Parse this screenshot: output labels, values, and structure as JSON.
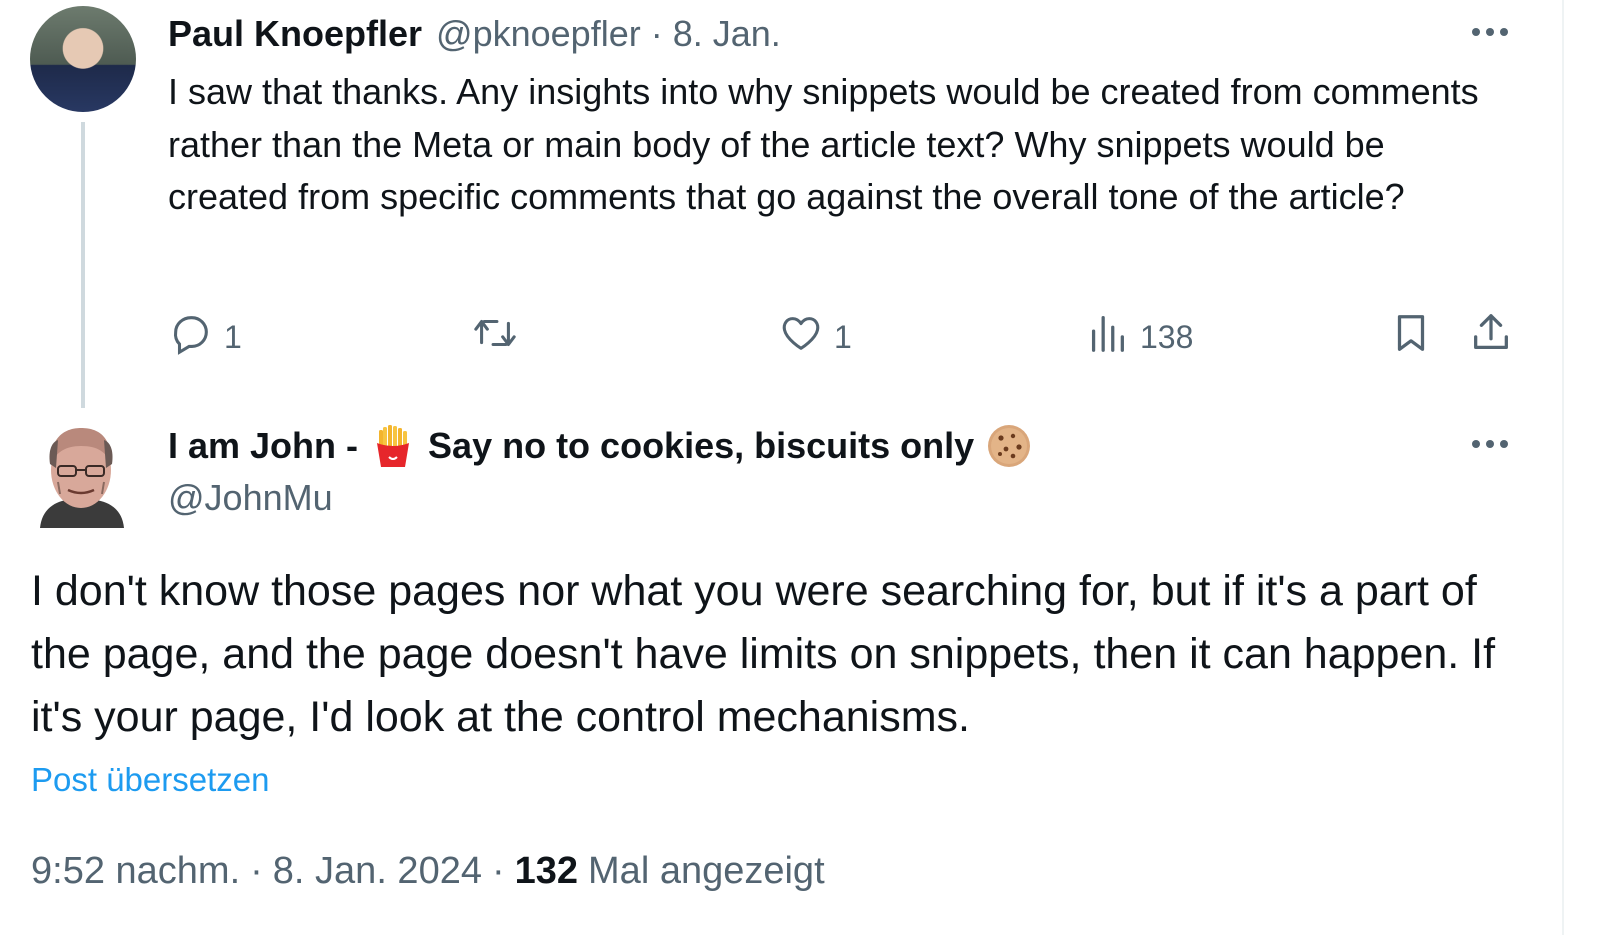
{
  "reply": {
    "author_name": "Paul Knoepfler",
    "author_handle": "@pknoepfler",
    "separator": "·",
    "date": "8. Jan.",
    "text": "I saw that thanks. Any insights into why snippets would be created from comments rather than the Meta or main body of the article text? Why snippets would be created from specific comments that go against the overall tone of the article?",
    "more_icon": "more-horizontal-icon",
    "actions": {
      "reply_count": "1",
      "retweet_count": "",
      "like_count": "1",
      "views_count": "138"
    }
  },
  "tweet": {
    "author_name_part1": "I am John -",
    "emoji1": "fries-emoji",
    "author_name_part2": "Say no to cookies, biscuits only",
    "emoji2": "cookie-emoji",
    "author_handle": "@JohnMu",
    "text": "I don't know those pages nor what you were searching for, but if it's a part of the page, and the page doesn't have limits on snippets, then it can happen. If it's your page, I'd look at the control mechanisms.",
    "translate_label": "Post übersetzen",
    "time": "9:52 nachm.",
    "date": "8. Jan. 2024",
    "views_count": "132",
    "views_label": "Mal angezeigt",
    "separator": "·"
  },
  "colors": {
    "text_primary": "#0f1419",
    "text_secondary": "#536471",
    "link": "#1d9bf0",
    "thread_line": "#cfd9de"
  }
}
